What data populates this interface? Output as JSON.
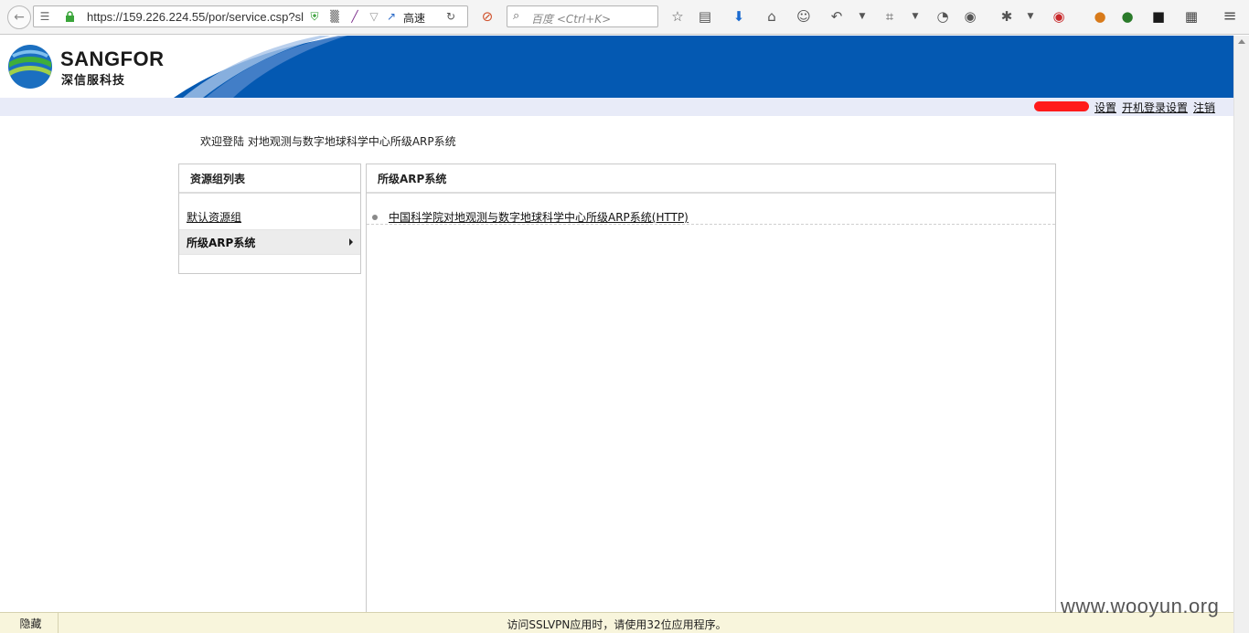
{
  "browser": {
    "url": "https://159.226.224.55/por/service.csp?sl",
    "speed_label": "高速",
    "search_placeholder": "百度 <Ctrl+K>"
  },
  "brand": {
    "name": "SANGFOR",
    "name_cn": "深信服科技",
    "banner_color": "#0459b2"
  },
  "userbar": {
    "links": [
      "设置",
      "开机登录设置",
      "注销"
    ]
  },
  "welcome_text": "欢迎登陆 对地观测与数字地球科学中心所级ARP系统",
  "left_panel": {
    "title": "资源组列表",
    "items": [
      {
        "label": "默认资源组"
      },
      {
        "label": "所级ARP系统"
      }
    ]
  },
  "right_panel": {
    "title": "所级ARP系统",
    "resources": [
      {
        "label": "中国科学院对地观测与数字地球科学中心所级ARP系统(HTTP)"
      }
    ]
  },
  "statusbar": {
    "hide_label": "隐藏",
    "message": "访问SSLVPN应用时，请使用32位应用程序。"
  },
  "watermark": "www.wooyun.org"
}
